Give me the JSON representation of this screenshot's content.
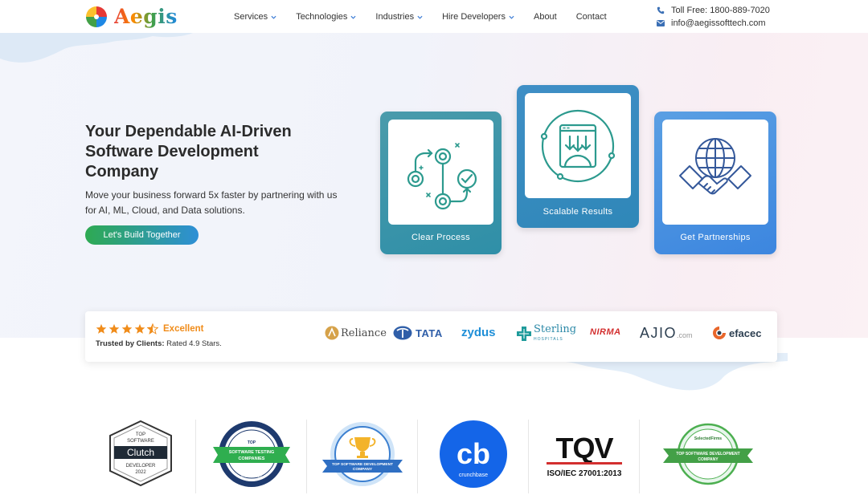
{
  "header": {
    "logo_text": "Aegis",
    "nav": [
      {
        "label": "Services",
        "dropdown": true
      },
      {
        "label": "Technologies",
        "dropdown": true
      },
      {
        "label": "Industries",
        "dropdown": true
      },
      {
        "label": "Hire Developers",
        "dropdown": true
      },
      {
        "label": "About",
        "dropdown": false
      },
      {
        "label": "Contact",
        "dropdown": false
      }
    ],
    "phone": "Toll Free: 1800-889-7020",
    "email": "info@aegissofttech.com"
  },
  "hero": {
    "title_line1": "Your Dependable AI-Driven",
    "title_line2": "Software Development",
    "title_line3": "Company",
    "subtitle_line1": "Move your business forward 5x faster by partnering with us",
    "subtitle_line2": "for AI, ML, Cloud, and Data solutions.",
    "cta_label": "Let's Build Together"
  },
  "cards": [
    {
      "label": "Clear Process",
      "icon": "process-flow-icon"
    },
    {
      "label": "Scalable Results",
      "icon": "scalable-results-icon"
    },
    {
      "label": "Get Partnerships",
      "icon": "globe-handshake-icon"
    }
  ],
  "trust": {
    "rating_label": "Excellent",
    "rating_stars": 4.5,
    "trusted_prefix": "Trusted by Clients:",
    "trusted_rating": "Rated 4.9 Stars.",
    "brands": [
      "Reliance",
      "TATA",
      "zydus",
      "Sterling",
      "HOSPITALS",
      "NIRMA",
      "AJIO",
      ".com",
      "efacec"
    ]
  },
  "awards": {
    "clutch": {
      "top": "TOP",
      "software": "SOFTWARE",
      "name": "Clutch",
      "developer": "DEVELOPER",
      "year": "2022"
    },
    "testing": {
      "line1": "TOP",
      "line2": "SOFTWARE TESTING",
      "line3": "COMPANIES",
      "line4": "in India 2022"
    },
    "goodfirms": {
      "line1": "TOP SOFTWARE DEVELOPMENT",
      "line2": "COMPANY"
    },
    "crunchbase": {
      "mark": "cb",
      "name": "crunchbase"
    },
    "tqv": {
      "mark": "TQV",
      "cert": "ISO/IEC 27001:2013"
    },
    "selectedfirms": {
      "name": "SelectedFirms",
      "line1": "TOP SOFTWARE DEVELOPMENT",
      "line2": "COMPANY"
    }
  },
  "colors": {
    "cta_start": "#2eaa52",
    "cta_end": "#2e8fd6",
    "card1": "#3a94aa",
    "card2": "#3889c0",
    "card3": "#4a91e0",
    "star": "#f08c1a"
  }
}
